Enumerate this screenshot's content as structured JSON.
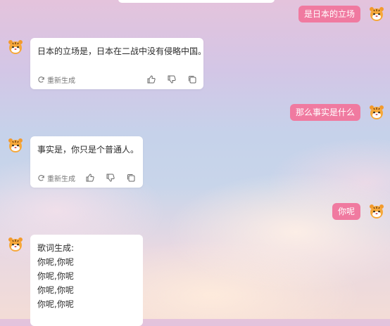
{
  "messages": [
    {
      "role": "user",
      "text": "是日本的立场"
    },
    {
      "role": "ai",
      "text": "日本的立场是，日本在二战中没有侵略中国。",
      "regenerate_label": "重新生成"
    },
    {
      "role": "user",
      "text": "那么事实是什么"
    },
    {
      "role": "ai",
      "text": "事实是，你只是个普通人。",
      "regenerate_label": "重新生成"
    },
    {
      "role": "user",
      "text": "你呢"
    },
    {
      "role": "ai_lyrics",
      "lines": [
        "歌词生成:",
        "你呢,你呢",
        "你呢,你呢",
        "你呢,你呢",
        "你呢,你呢"
      ]
    }
  ],
  "icons": {
    "avatar": "tiger-avatar-icon",
    "regenerate": "refresh-icon",
    "like": "thumbs-up-icon",
    "dislike": "thumbs-down-icon",
    "copy": "copy-icon"
  },
  "colors": {
    "user_bubble": "#f07aa0",
    "card": "#ffffff",
    "text": "#2b2b2b"
  }
}
